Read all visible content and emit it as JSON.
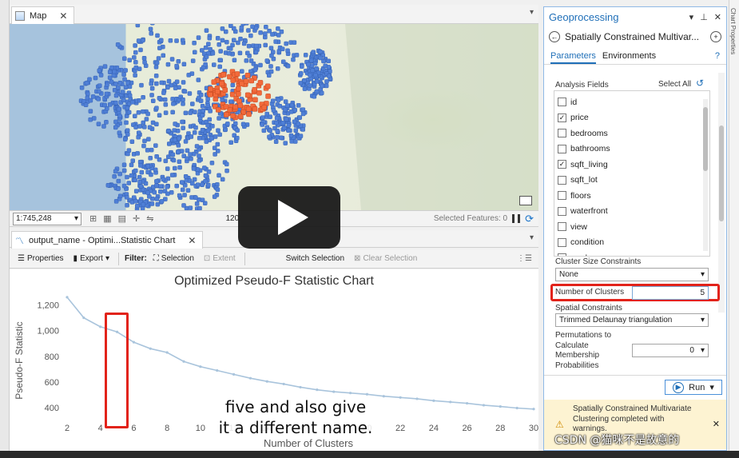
{
  "map_pane": {
    "tab_label": "Map",
    "scale_value": "1:745,248",
    "rotation_value": "120",
    "selected_features": "Selected Features: 0"
  },
  "chart_pane": {
    "tab_label": "output_name - Optimi...Statistic Chart",
    "toolbar": {
      "properties": "Properties",
      "export": "Export",
      "filter": "Filter:",
      "selection": "Selection",
      "extent": "Extent",
      "switch_selection": "Switch Selection",
      "clear_selection": "Clear Selection"
    }
  },
  "chart_data": {
    "type": "line",
    "title": "Optimized Pseudo-F Statistic Chart",
    "xlabel": "Number of Clusters",
    "ylabel": "Pseudo-F Statistic",
    "x_ticks": [
      2,
      4,
      6,
      8,
      10,
      12,
      14,
      16,
      18,
      20,
      22,
      24,
      26,
      28,
      30
    ],
    "y_ticks": [
      400,
      600,
      800,
      1000,
      1200
    ],
    "y_tick_labels": [
      "400",
      "600",
      "800",
      "1,000",
      "1,200"
    ],
    "xlim": [
      2,
      30
    ],
    "ylim": [
      370,
      1290
    ],
    "x": [
      2,
      3,
      4,
      5,
      6,
      7,
      8,
      9,
      10,
      11,
      12,
      13,
      14,
      15,
      16,
      17,
      18,
      19,
      20,
      21,
      22,
      23,
      24,
      25,
      26,
      27,
      28,
      29,
      30
    ],
    "values": [
      1260,
      1100,
      1030,
      990,
      910,
      860,
      830,
      760,
      720,
      690,
      660,
      630,
      605,
      585,
      560,
      540,
      525,
      515,
      505,
      490,
      480,
      470,
      455,
      445,
      435,
      420,
      410,
      398,
      390
    ],
    "color": "#a9c4dc",
    "highlight_x": 5
  },
  "geoprocessing": {
    "header": "Geoprocessing",
    "tool_name": "Spatially Constrained Multivar...",
    "tabs": [
      "Parameters",
      "Environments"
    ],
    "analysis_fields_label": "Analysis Fields",
    "select_all": "Select All",
    "fields": [
      {
        "name": "id",
        "checked": false
      },
      {
        "name": "price",
        "checked": true
      },
      {
        "name": "bedrooms",
        "checked": false
      },
      {
        "name": "bathrooms",
        "checked": false
      },
      {
        "name": "sqft_living",
        "checked": true
      },
      {
        "name": "sqft_lot",
        "checked": false
      },
      {
        "name": "floors",
        "checked": false
      },
      {
        "name": "waterfront",
        "checked": false
      },
      {
        "name": "view",
        "checked": false
      },
      {
        "name": "condition",
        "checked": false
      },
      {
        "name": "grade",
        "checked": false
      }
    ],
    "cluster_size_label": "Cluster Size Constraints",
    "cluster_size_value": "None",
    "num_clusters_label": "Number of Clusters",
    "num_clusters_value": "5",
    "spatial_constraints_label": "Spatial Constraints",
    "spatial_constraints_value": "Trimmed Delaunay triangulation",
    "permutations_label": [
      "Permutations to",
      "Calculate",
      "Membership",
      "Probabilities"
    ],
    "permutations_value": "0",
    "run_label": "Run",
    "warning_text": [
      "Spatially Constrained Multivariate",
      "Clustering completed with",
      "warnings."
    ]
  },
  "side_panel_label": "Chart Properties",
  "video": {
    "caption_line1": "five and also give",
    "caption_line2": "it a different name."
  },
  "watermark": "CSDN @猫咪不是故意的",
  "colors": {
    "accent": "#1f6fb8",
    "highlight_red": "#e2231a",
    "map_points": "#4f7fd6",
    "map_cluster": "#f26a3b"
  }
}
